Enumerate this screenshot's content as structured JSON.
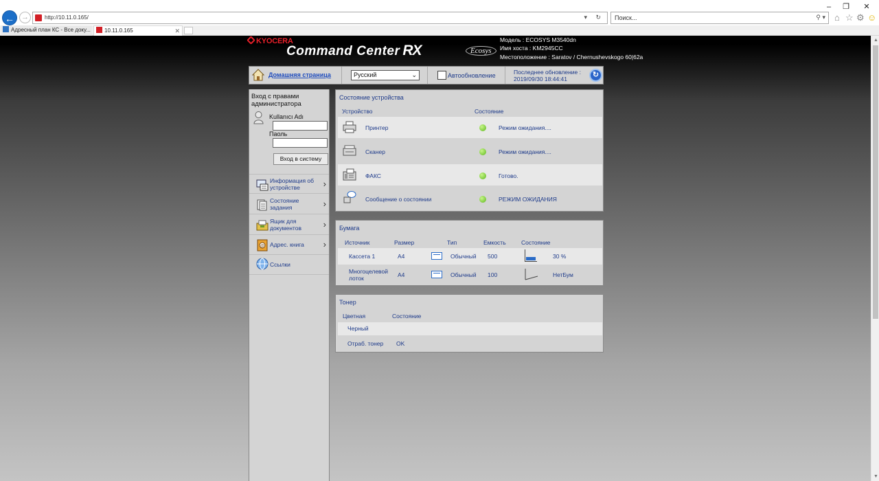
{
  "browser": {
    "url": "http://10.11.0.165/",
    "search_placeholder": "Поиск...",
    "tabs": [
      {
        "label": "Адресный план КС - Все доку..."
      },
      {
        "label": "10.11.0.165"
      }
    ]
  },
  "header": {
    "brand": "KYOCERA",
    "product": "Command Center",
    "product_suffix": "RX",
    "ecosys": "Ecosys",
    "model": "Модель : ECOSYS M3540dn",
    "hostname": "Имя хоста : KM2945CC",
    "location": "Местоположение : Saratov / Chernushevskogo 60|62a"
  },
  "topbar": {
    "home": "Домашняя страница",
    "language": "Русский",
    "auto_refresh": "Автообновление",
    "last_update_label": "Последнее обновление :",
    "last_update_value": "2019/09/30 18:44:41"
  },
  "sidebar": {
    "login_title": "Вход с правами администратора",
    "username_label": "Kullanıcı Adı",
    "password_label": "Паоль",
    "login_button": "Вход в систему",
    "nav": [
      {
        "label": "Информация об устройстве"
      },
      {
        "label": "Состояние задания"
      },
      {
        "label": "Ящик для документов"
      },
      {
        "label": "Адрес. книга"
      },
      {
        "label": "Ссылки"
      }
    ]
  },
  "device_status": {
    "title": "Состояние устройства",
    "col_device": "Устройство",
    "col_status": "Состояние",
    "rows": [
      {
        "device": "Принтер",
        "status": "Режим ожидания...."
      },
      {
        "device": "Сканер",
        "status": "Режим ожидания...."
      },
      {
        "device": "ФАКС",
        "status": "Готово."
      },
      {
        "device": "Сообщение о состоянии",
        "status": "РЕЖИМ ОЖИДАНИЯ"
      }
    ],
    "status_color": "#5cb81c"
  },
  "paper": {
    "title": "Бумага",
    "columns": [
      "Источник",
      "Размер",
      "Тип",
      "Емкость",
      "Состояние"
    ],
    "rows": [
      {
        "source": "Кассета 1",
        "size": "A4",
        "type": "Обычный",
        "capacity": "500",
        "status": "30 %",
        "level": 0.3
      },
      {
        "source": "Многоцелевой лоток",
        "size": "A4",
        "type": "Обычный",
        "capacity": "100",
        "status": "НетБум",
        "level": 0
      }
    ]
  },
  "toner": {
    "title": "Тонер",
    "col_color": "Цветная",
    "col_status": "Состояние",
    "color_black": "Черный",
    "waste_label": "Отраб. тонер",
    "waste_status": "OK"
  }
}
